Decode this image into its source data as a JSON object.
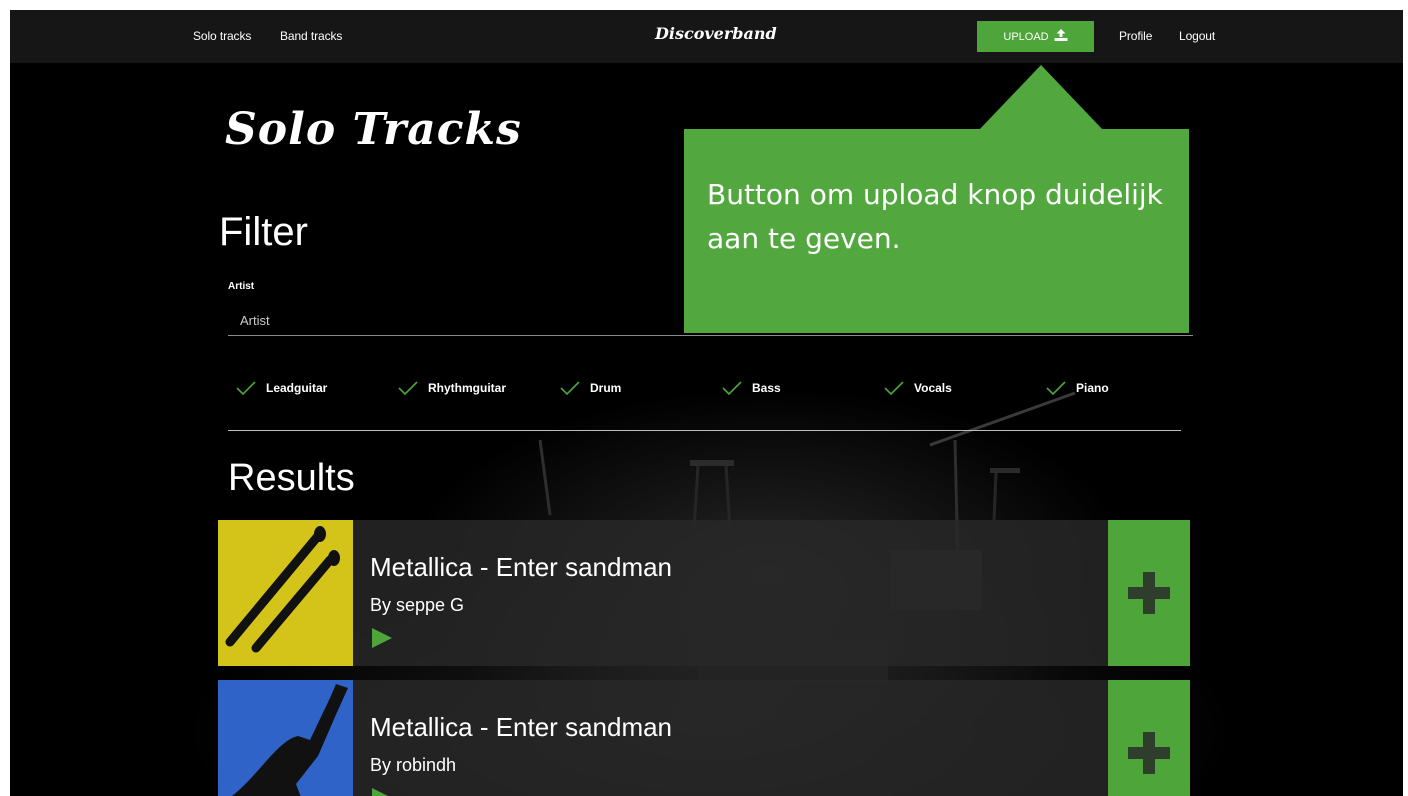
{
  "nav": {
    "solo_tracks": "Solo tracks",
    "band_tracks": "Band tracks",
    "brand": "Discoverband",
    "upload": "UPLOAD",
    "profile": "Profile",
    "logout": "Logout"
  },
  "page": {
    "title": "Solo Tracks",
    "filter_heading": "Filter",
    "results_heading": "Results"
  },
  "filter": {
    "artist_label": "Artist",
    "artist_placeholder": "Artist",
    "instruments": [
      {
        "label": "Leadguitar",
        "checked": true
      },
      {
        "label": "Rhythmguitar",
        "checked": true
      },
      {
        "label": "Drum",
        "checked": true
      },
      {
        "label": "Bass",
        "checked": true
      },
      {
        "label": "Vocals",
        "checked": true
      },
      {
        "label": "Piano",
        "checked": true
      }
    ]
  },
  "tracks": [
    {
      "title": "Metallica - Enter sandman",
      "by": "By seppe G",
      "thumb_color": "#d4c319",
      "icon": "drumsticks-icon"
    },
    {
      "title": "Metallica - Enter sandman",
      "by": "By robindh",
      "thumb_color": "#2f63c7",
      "icon": "guitar-icon"
    }
  ],
  "callout": {
    "text": "Button om upload knop duidelijk aan te geven."
  },
  "colors": {
    "accent": "#4ea63a",
    "navbar": "#161616",
    "check": "#4ea63a"
  }
}
